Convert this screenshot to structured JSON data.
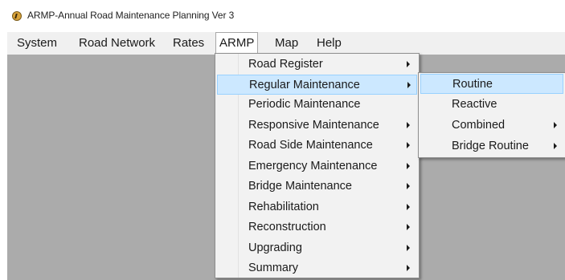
{
  "window": {
    "title": "ARMP-Annual Road Maintenance Planning Ver 3",
    "icon": "app-logo-icon"
  },
  "menubar": {
    "items": [
      {
        "label": "System"
      },
      {
        "label": "Road Network"
      },
      {
        "label": "Rates"
      },
      {
        "label": "ARMP",
        "active": true
      },
      {
        "label": "Map"
      },
      {
        "label": "Help"
      }
    ]
  },
  "armp_menu": {
    "items": [
      {
        "label": "Road Register",
        "has_submenu": true
      },
      {
        "label": "Regular Maintenance",
        "has_submenu": true,
        "highlighted": true
      },
      {
        "label": "Periodic Maintenance",
        "has_submenu": false
      },
      {
        "label": "Responsive Maintenance",
        "has_submenu": true
      },
      {
        "label": "Road Side Maintenance",
        "has_submenu": true
      },
      {
        "label": "Emergency Maintenance",
        "has_submenu": true
      },
      {
        "label": "Bridge Maintenance",
        "has_submenu": true
      },
      {
        "label": "Rehabilitation",
        "has_submenu": true
      },
      {
        "label": "Reconstruction",
        "has_submenu": true
      },
      {
        "label": "Upgrading",
        "has_submenu": true
      },
      {
        "label": "Summary",
        "has_submenu": true
      }
    ]
  },
  "regular_maintenance_submenu": {
    "items": [
      {
        "label": "Routine",
        "has_submenu": false,
        "highlighted": true
      },
      {
        "label": "Reactive",
        "has_submenu": false
      },
      {
        "label": "Combined",
        "has_submenu": true
      },
      {
        "label": "Bridge Routine",
        "has_submenu": true
      }
    ]
  },
  "colors": {
    "client_area": "#ababab",
    "menubar": "#f0f0f0",
    "menu_background": "#f2f2f2",
    "highlight": "#cce8ff",
    "highlight_border": "#99d1ff"
  }
}
